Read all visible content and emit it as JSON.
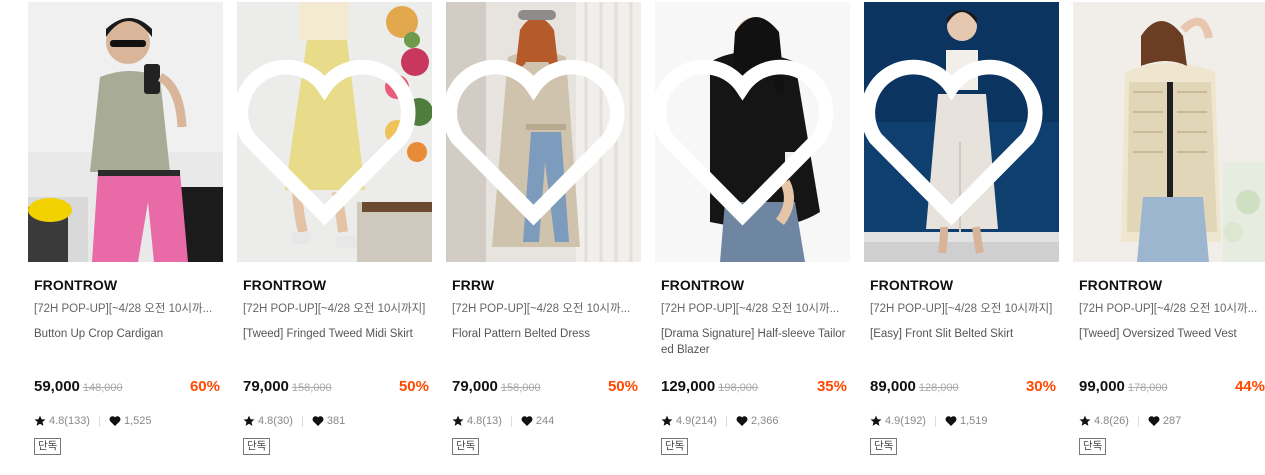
{
  "products": [
    {
      "brand": "FRONTROW",
      "promo": "[72H POP-UP][~4/28 오전 10시까...",
      "name": "Button Up Crop Cardigan",
      "price": "59,000",
      "original_price": "148,000",
      "discount": "60%",
      "rating": "4.8(133)",
      "likes": "1,525",
      "badge": "단독"
    },
    {
      "brand": "FRONTROW",
      "promo": "[72H POP-UP][~4/28 오전 10시까지]",
      "name": "[Tweed] Fringed Tweed Midi Skirt",
      "price": "79,000",
      "original_price": "158,000",
      "discount": "50%",
      "rating": "4.8(30)",
      "likes": "381",
      "badge": "단독"
    },
    {
      "brand": "FRRW",
      "promo": "[72H POP-UP][~4/28 오전 10시까...",
      "name": "Floral Pattern Belted Dress",
      "price": "79,000",
      "original_price": "158,000",
      "discount": "50%",
      "rating": "4.8(13)",
      "likes": "244",
      "badge": "단독"
    },
    {
      "brand": "FRONTROW",
      "promo": "[72H POP-UP][~4/28 오전 10시까...",
      "name": "[Drama Signature] Half-sleeve Tailored Blazer",
      "price": "129,000",
      "original_price": "198,000",
      "discount": "35%",
      "rating": "4.9(214)",
      "likes": "2,366",
      "badge": "단독"
    },
    {
      "brand": "FRONTROW",
      "promo": "[72H POP-UP][~4/28 오전 10시까지]",
      "name": "[Easy] Front Slit Belted Skirt",
      "price": "89,000",
      "original_price": "128,000",
      "discount": "30%",
      "rating": "4.9(192)",
      "likes": "1,519",
      "badge": "단독"
    },
    {
      "brand": "FRONTROW",
      "promo": "[72H POP-UP][~4/28 오전 10시까...",
      "name": "[Tweed] Oversized Tweed Vest",
      "price": "99,000",
      "original_price": "178,000",
      "discount": "44%",
      "rating": "4.8(26)",
      "likes": "287",
      "badge": "단독"
    }
  ],
  "colors": {
    "discount": "#ff4800",
    "brand_text": "#111111",
    "meta_text": "#888888"
  },
  "icons": {
    "wishlist": "heart-outline-icon",
    "rating": "star-icon",
    "likes": "heart-filled-icon"
  }
}
